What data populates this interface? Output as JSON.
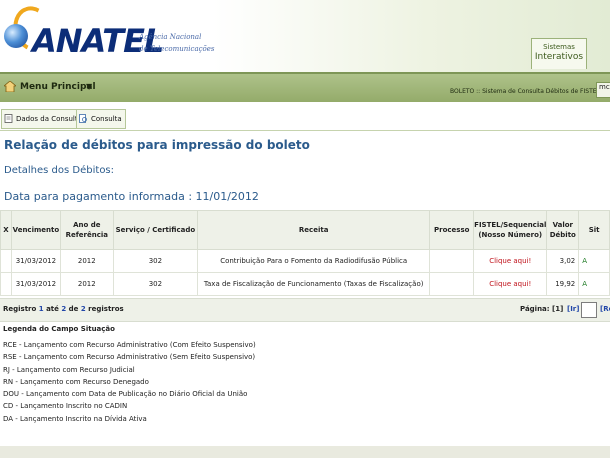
{
  "header": {
    "logo_text": "ANATEL",
    "logo_subtitle_line1": "Agência Nacional",
    "logo_subtitle_line2": "de Telecomunicações",
    "systems_tab_line1": "Sistemas",
    "systems_tab_line2": "Interativos"
  },
  "menubar": {
    "menu_label": "Menu Principal",
    "system_description": "BOLETO :: Sistema de Consulta Débitos de FISTEL",
    "user_text": "mc"
  },
  "subtabs": [
    {
      "label": "Dados da Consulta"
    },
    {
      "label": "Consulta"
    }
  ],
  "page": {
    "title": "Relação de débitos para impressão do boleto",
    "subtitle": "Detalhes dos Débitos:",
    "payment_date_text": "Data para pagamento informada : 11/01/2012"
  },
  "table": {
    "headers": [
      "X",
      "Vencimento",
      "Ano de Referência",
      "Serviço / Certificado",
      "Receita",
      "Processo",
      "FISTEL/Sequencial (Nosso Número)",
      "Valor Débito",
      "Sit"
    ],
    "rows": [
      {
        "vencimento": "31/03/2012",
        "ano": "2012",
        "servico": "302",
        "receita": "Contribuição Para o Fomento da Radiodifusão Pública",
        "processo": "",
        "fistel": "Clique aqui!",
        "valor": "3,02",
        "situacao": "A"
      },
      {
        "vencimento": "31/03/2012",
        "ano": "2012",
        "servico": "302",
        "receita": "Taxa de Fiscalização de Funcionamento (Taxas de Fiscalização)",
        "processo": "",
        "fistel": "Clique aqui!",
        "valor": "19,92",
        "situacao": "A"
      }
    ]
  },
  "pager": {
    "reg_prefix": "Registro",
    "reg_from": "1",
    "reg_mid": "até",
    "reg_to": "2",
    "reg_of": "de",
    "reg_total": "2",
    "reg_suffix": "registros",
    "page_label": "Página: [1]",
    "next_label": "[Ir]",
    "last_label": "[Re"
  },
  "legend": {
    "title": "Legenda do Campo Situação",
    "items": [
      "RCE - Lançamento com Recurso Administrativo (Com Efeito Suspensivo)",
      "RSE - Lançamento com Recurso Administrativo (Sem Efeito Suspensivo)",
      "RJ - Lançamento com Recurso Judicial",
      "RN - Lançamento com Recurso Denegado",
      "DOU - Lançamento com Data de Publicação no Diário Oficial da União",
      "CD - Lançamento Inscrito no CADIN",
      "DA - Lançamento Inscrito na Dívida Ativa"
    ]
  },
  "colors": {
    "accent_blue": "#2b5b8c",
    "menubar_green": "#94ab6a",
    "link_red": "#c0121b"
  }
}
